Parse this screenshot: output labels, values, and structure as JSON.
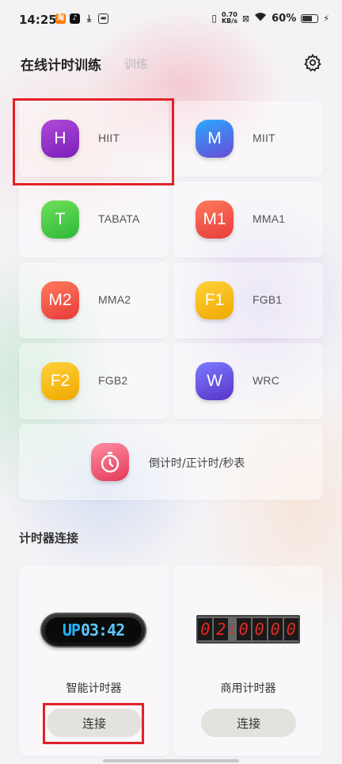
{
  "status_bar": {
    "time": "14:25",
    "net_speed_value": "0.70",
    "net_speed_unit": "KB/s",
    "battery": "60%"
  },
  "header": {
    "title": "在线计时训练",
    "tab_training": "训练"
  },
  "modes": [
    {
      "letter": "H",
      "label": "HIIT",
      "color_top": "#b04ad9",
      "color_bottom": "#7a1fb8"
    },
    {
      "letter": "M",
      "label": "MIIT",
      "color_top": "#2aa9ff",
      "color_bottom": "#6a4bd6"
    },
    {
      "letter": "T",
      "label": "TABATA",
      "color_top": "#6fe05a",
      "color_bottom": "#2fb83a"
    },
    {
      "letter": "M1",
      "label": "MMA1",
      "color_top": "#ff7a5c",
      "color_bottom": "#e83b3b"
    },
    {
      "letter": "M2",
      "label": "MMA2",
      "color_top": "#ff7a5c",
      "color_bottom": "#e83b3b"
    },
    {
      "letter": "F1",
      "label": "FGB1",
      "color_top": "#ffd23a",
      "color_bottom": "#f0a800"
    },
    {
      "letter": "F2",
      "label": "FGB2",
      "color_top": "#ffd23a",
      "color_bottom": "#f0a800"
    },
    {
      "letter": "W",
      "label": "WRC",
      "color_top": "#7a7bff",
      "color_bottom": "#5a34c8"
    }
  ],
  "timer_tile": {
    "label": "倒计时/正计时/秒表"
  },
  "section": {
    "title": "计时器连接"
  },
  "devices": [
    {
      "name": "智能计时器",
      "button": "连接",
      "display_prefix": "UP",
      "display_digits": "03:42"
    },
    {
      "name": "商用计时器",
      "button": "连接",
      "display_digits": [
        "0",
        "2",
        "0",
        "0",
        "0",
        "0"
      ]
    }
  ]
}
